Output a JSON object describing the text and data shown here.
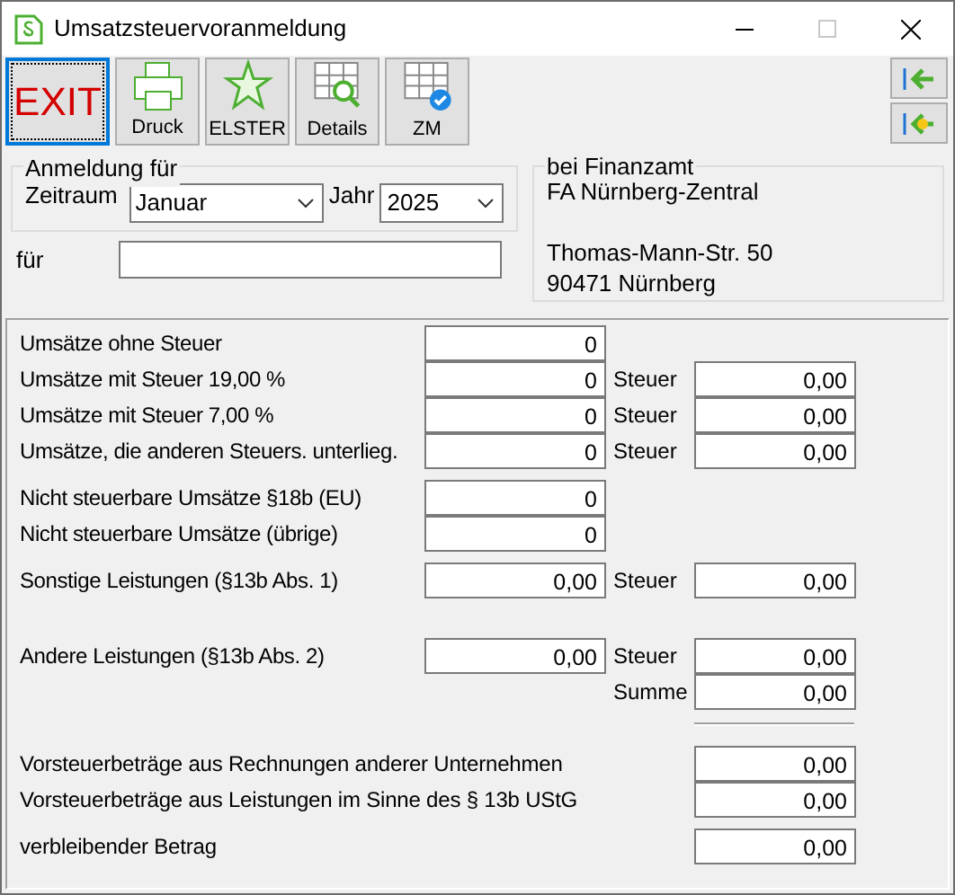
{
  "window": {
    "title": "Umsatzsteuervoranmeldung"
  },
  "toolbar": [
    {
      "kind": "exit",
      "label": "EXIT",
      "focused": true
    },
    {
      "kind": "print",
      "label": "Druck",
      "focused": false
    },
    {
      "kind": "elster",
      "label": "ELSTER",
      "focused": false
    },
    {
      "kind": "details",
      "label": "Details",
      "focused": false
    },
    {
      "kind": "zm",
      "label": "ZM",
      "focused": false
    }
  ],
  "anmeldung": {
    "title": "Anmeldung für",
    "zeitraum_label": "Zeitraum",
    "zeitraum": "Januar",
    "jahr_label": "Jahr",
    "jahr": "2025",
    "fuer_label": "für"
  },
  "finanzamt": {
    "title": "bei Finanzamt",
    "name": "FA Nürnberg-Zentral",
    "address": [
      "Thomas-Mann-Str. 50",
      "90471 Nürnberg"
    ]
  },
  "umsaetze": [
    {
      "label": "Umsätze ohne Steuer",
      "value": "0"
    },
    {
      "label": "Umsätze mit Steuer 19,00 %",
      "value": "0",
      "tax_label": "Steuer",
      "tax": "0,00"
    },
    {
      "label": "Umsätze mit Steuer 7,00 %",
      "value": "0",
      "tax_label": "Steuer",
      "tax": "0,00"
    },
    {
      "label": "Umsätze, die anderen Steuers. unterlieg.",
      "value": "0",
      "tax_label": "Steuer",
      "tax": "0,00"
    }
  ],
  "nicht_steuerbar": [
    {
      "label": "Nicht steuerbare Umsätze §18b (EU)",
      "value": "0"
    },
    {
      "label": "Nicht steuerbare Umsätze (übrige)",
      "value": "0"
    }
  ],
  "sonstige": {
    "label": "Sonstige Leistungen (§13b Abs. 1)",
    "value": "0,00",
    "tax_label": "Steuer",
    "tax": "0,00"
  },
  "andere": {
    "label": "Andere Leistungen (§13b Abs. 2)",
    "value": "0,00",
    "tax_label": "Steuer",
    "tax": "0,00",
    "sum_label": "Summe",
    "sum": "0,00"
  },
  "vorsteuer": [
    {
      "label": "Vorsteuerbeträge aus Rechnungen anderer Unternehmen",
      "value": "0,00"
    },
    {
      "label": "Vorsteuerbeträge aus Leistungen im Sinne des § 13b UStG",
      "value": "0,00"
    }
  ],
  "verbleibend": {
    "label": "verbleibender Betrag",
    "value": "0,00"
  }
}
